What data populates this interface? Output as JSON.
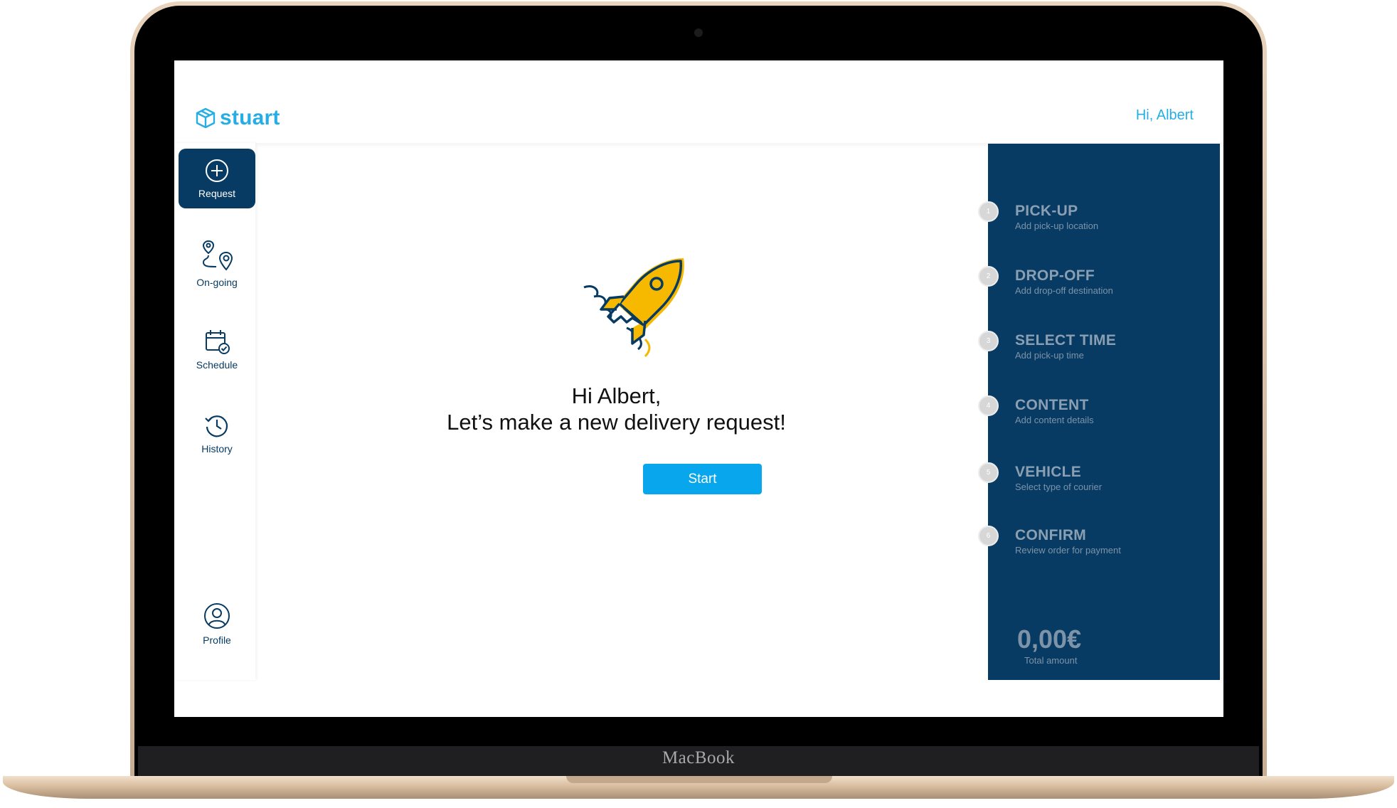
{
  "device": {
    "label": "MacBook"
  },
  "header": {
    "brand": "stuart",
    "greeting": "Hi, Albert"
  },
  "sidebar": {
    "items": [
      {
        "label": "Request",
        "icon": "plus-circle-icon",
        "active": true
      },
      {
        "label": "On-going",
        "icon": "route-pin-icon",
        "active": false
      },
      {
        "label": "Schedule",
        "icon": "calendar-check-icon",
        "active": false
      },
      {
        "label": "History",
        "icon": "history-clock-icon",
        "active": false
      },
      {
        "label": "Profile",
        "icon": "user-profile-icon",
        "active": false
      }
    ]
  },
  "main": {
    "illustration": "rocket-icon",
    "headline_line1": "Hi Albert,",
    "headline_line2": "Let’s make a new delivery request!",
    "start_label": "Start"
  },
  "steps": [
    {
      "num": "1",
      "title": "PICK-UP",
      "subtitle": "Add pick-up location"
    },
    {
      "num": "2",
      "title": "DROP-OFF",
      "subtitle": "Add drop-off destination"
    },
    {
      "num": "3",
      "title": "SELECT TIME",
      "subtitle": "Add pick-up time"
    },
    {
      "num": "4",
      "title": "CONTENT",
      "subtitle": "Add content details"
    },
    {
      "num": "5",
      "title": "VEHICLE",
      "subtitle": "Select type of courier"
    },
    {
      "num": "6",
      "title": "CONFIRM",
      "subtitle": "Review order for payment"
    }
  ],
  "total": {
    "amount": "0,00€",
    "label": "Total amount"
  },
  "colors": {
    "brand": "#26aee4",
    "navy": "#073b63",
    "button": "#08a6ec",
    "accent": "#f6b900"
  }
}
